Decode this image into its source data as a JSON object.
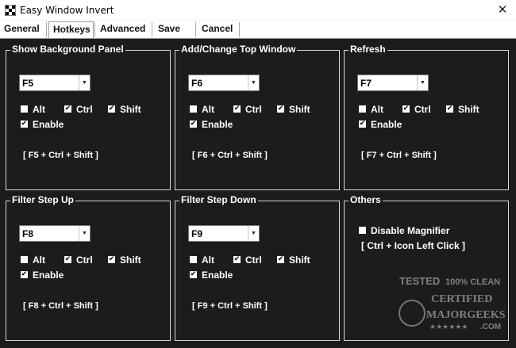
{
  "window": {
    "title": "Easy Window Invert",
    "close_glyph": "✕"
  },
  "tabs": [
    {
      "label": "General"
    },
    {
      "label": "Hotkeys"
    },
    {
      "label": "Advanced"
    },
    {
      "label": "Save"
    },
    {
      "label": "Cancel"
    }
  ],
  "groups": [
    {
      "title": "Show Background Panel",
      "key": "F5",
      "alt": "Alt",
      "ctrl": "Ctrl",
      "shift": "Shift",
      "enable": "Enable",
      "combo": "[ F5 + Ctrl + Shift ]"
    },
    {
      "title": "Add/Change Top Window",
      "key": "F6",
      "alt": "Alt",
      "ctrl": "Ctrl",
      "shift": "Shift",
      "enable": "Enable",
      "combo": "[ F6 + Ctrl + Shift ]"
    },
    {
      "title": "Refresh",
      "key": "F7",
      "alt": "Alt",
      "ctrl": "Ctrl",
      "shift": "Shift",
      "enable": "Enable",
      "combo": "[ F7 + Ctrl + Shift ]"
    },
    {
      "title": "Filter Step Up",
      "key": "F8",
      "alt": "Alt",
      "ctrl": "Ctrl",
      "shift": "Shift",
      "enable": "Enable",
      "combo": "[ F8 + Ctrl + Shift ]"
    },
    {
      "title": "Filter Step Down",
      "key": "F9",
      "alt": "Alt",
      "ctrl": "Ctrl",
      "shift": "Shift",
      "enable": "Enable",
      "combo": "[ F9 + Ctrl + Shift ]"
    }
  ],
  "others": {
    "title": "Others",
    "disable_magnifier": "Disable Magnifier",
    "hint": "[ Ctrl + Icon Left Click ]"
  },
  "watermark": {
    "line1": "TESTED",
    "line2": "100% CLEAN",
    "line3": "CERTIFIED",
    "line4": "MAJORGEEKS",
    "line5": ".COM",
    "stars": "★★★★★★"
  },
  "colors": {
    "background": "#1c1c1c",
    "group_border": "#d8d8d8",
    "text": "#ffffff"
  }
}
